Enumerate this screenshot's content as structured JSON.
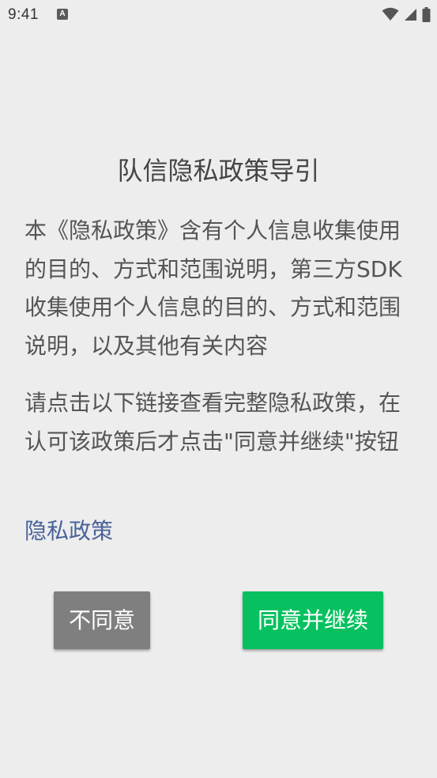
{
  "status_bar": {
    "time": "9:41",
    "app_icon_letter": "A",
    "icons": [
      "wifi-icon",
      "signal-icon",
      "battery-icon"
    ]
  },
  "dialog": {
    "title": "队信隐私政策导引",
    "paragraph_1": "本《隐私政策》含有个人信息收集使用的目的、方式和范围说明，第三方SDK收集使用个人信息的目的、方式和范围说明，以及其他有关内容",
    "paragraph_2": "请点击以下链接查看完整隐私政策，在认可该政策后才点击\"同意并继续\"按钮",
    "privacy_link": "隐私政策",
    "disagree_label": "不同意",
    "agree_label": "同意并继续"
  },
  "colors": {
    "background": "#ededed",
    "link": "#4a6399",
    "disagree_button": "#7f7f7f",
    "agree_button": "#07c160"
  }
}
